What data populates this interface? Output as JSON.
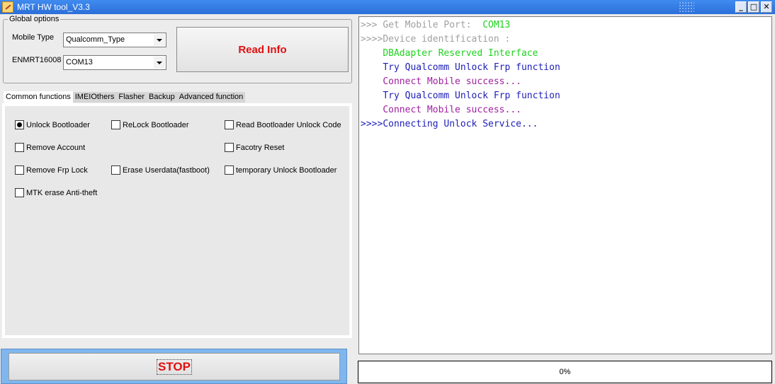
{
  "window": {
    "title": "MRT HW tool_V3.3",
    "controls": {
      "minimize": "_",
      "maximize": "□",
      "close": "✕"
    }
  },
  "global_options": {
    "legend": "Global options",
    "mobile_type": {
      "label": "Mobile Type",
      "value": "Qualcomm_Type"
    },
    "port": {
      "label": "ENMRT16008",
      "value": "COM13"
    },
    "read_info_label": "Read Info"
  },
  "tabs": [
    "Common functions",
    "IMEI",
    "Others",
    "Flasher",
    "Backup",
    "Advanced function"
  ],
  "options": {
    "unlock_bootloader": "Unlock Bootloader",
    "relock_bootloader": "ReLock Bootloader",
    "read_unlock_code": "Read Bootloader Unlock Code",
    "remove_account": "Remove Account",
    "factory_reset": "Facotry Reset",
    "remove_frp": "Remove Frp Lock",
    "erase_userdata": "Erase Userdata(fastboot)",
    "temp_unlock": "temporary Unlock Bootloader",
    "mtk_erase": "MTK erase Anti-theft",
    "selected": "Unlock Bootloader"
  },
  "stop_label": "STOP",
  "log": [
    {
      "prefix": ">>> ",
      "text": "Get Mobile Port:  ",
      "value": "COM13"
    },
    {
      "prefix": ">>>>",
      "text": "Device identification :"
    },
    {
      "prefix": "    ",
      "text": "DBAdapter Reserved Interface"
    },
    {
      "prefix": "    ",
      "text": "Try Qualcomm Unlock Frp function"
    },
    {
      "prefix": "    ",
      "text": "Connect Mobile success..."
    },
    {
      "prefix": "    ",
      "text": "Try Qualcomm Unlock Frp function"
    },
    {
      "prefix": "    ",
      "text": "Connect Mobile success..."
    },
    {
      "prefix": ">>>>",
      "text": "Connecting Unlock Service..."
    }
  ],
  "progress_text": "0%",
  "colors": {
    "log_gray": "#a0a0a0",
    "log_green": "#1ed21e",
    "log_blue": "#2020b8",
    "log_purple": "#a020a0",
    "accent_red": "#e01010"
  }
}
